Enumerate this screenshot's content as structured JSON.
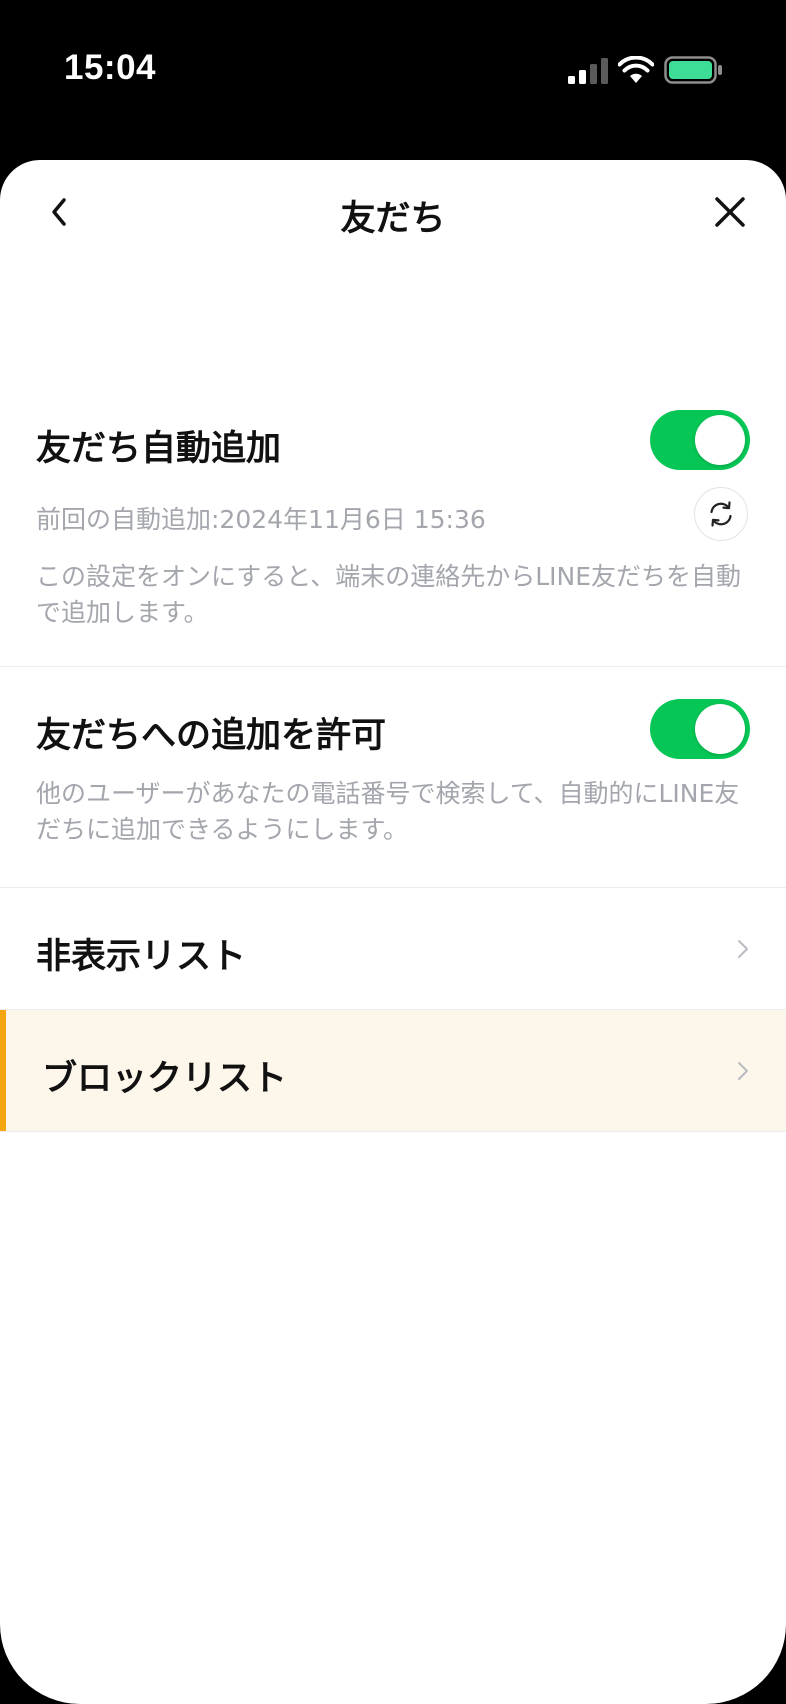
{
  "status_bar": {
    "time": "15:04",
    "battery_color": "#3ddc97"
  },
  "nav": {
    "title": "友だち",
    "back_icon": "chevron-left-icon",
    "close_icon": "close-icon"
  },
  "auto_add": {
    "title": "友だち自動追加",
    "enabled": true,
    "last_added": "前回の自動追加:2024年11月6日 15:36",
    "refresh_icon": "refresh-icon",
    "description": "この設定をオンにすると、端末の連絡先からLINE友だちを自動で追加します。"
  },
  "allow_add": {
    "title": "友だちへの追加を許可",
    "enabled": true,
    "description": "他のユーザーがあなたの電話番号で検索して、自動的にLINE友だちに追加できるようにします。"
  },
  "lists": [
    {
      "label": "非表示リスト",
      "highlighted": false
    },
    {
      "label": "ブロックリスト",
      "highlighted": true
    }
  ],
  "colors": {
    "toggle_on": "#06c755",
    "highlight_bg": "#fdf6ea",
    "highlight_accent": "#f5a50f"
  }
}
